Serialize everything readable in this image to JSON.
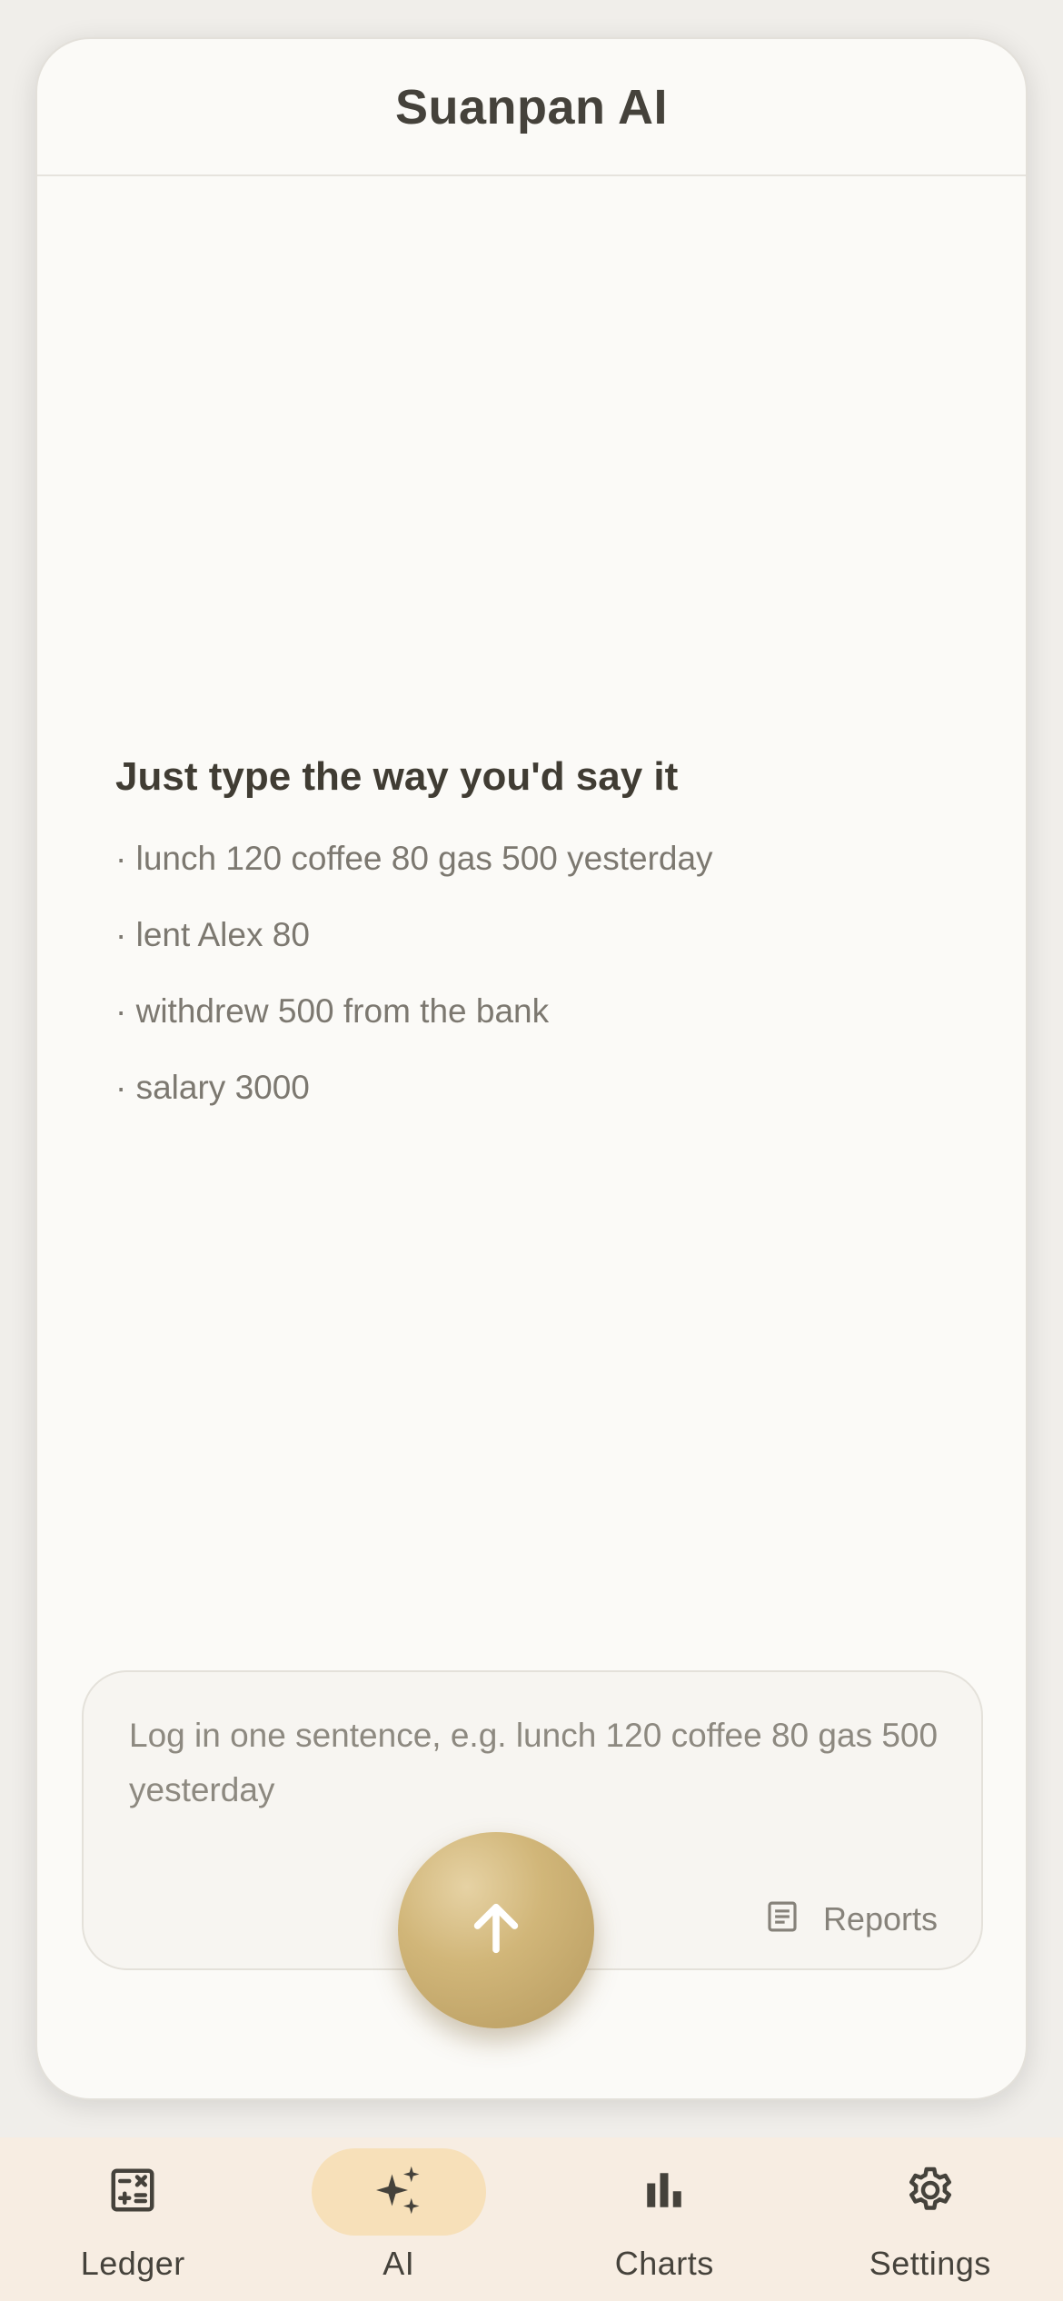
{
  "header": {
    "title": "Suanpan AI"
  },
  "tips": {
    "heading": "Just type the way you'd say it",
    "items": [
      "· lunch 120 coffee 80 gas 500 yesterday",
      "· lent Alex 80",
      "· withdrew 500 from the bank",
      "· salary 3000"
    ]
  },
  "composer": {
    "value": "",
    "placeholder": "Log in one sentence, e.g. lunch 120 coffee 80 gas 500 yesterday",
    "reports_label": "Reports",
    "reports_icon": "document-icon",
    "send_icon": "arrow-up-icon"
  },
  "nav": {
    "items": [
      {
        "label": "Ledger",
        "icon": "calculator-icon",
        "active": false
      },
      {
        "label": "AI",
        "icon": "sparkles-icon",
        "active": true
      },
      {
        "label": "Charts",
        "icon": "bar-chart-icon",
        "active": false
      },
      {
        "label": "Settings",
        "icon": "gear-icon",
        "active": false
      }
    ]
  },
  "colors": {
    "background": "#fbfaf7",
    "text": "#45423b",
    "muted": "#7c7870",
    "accent": "#c9ad6e",
    "nav_bg": "#f7ede2",
    "nav_active": "#f7e0b9"
  }
}
